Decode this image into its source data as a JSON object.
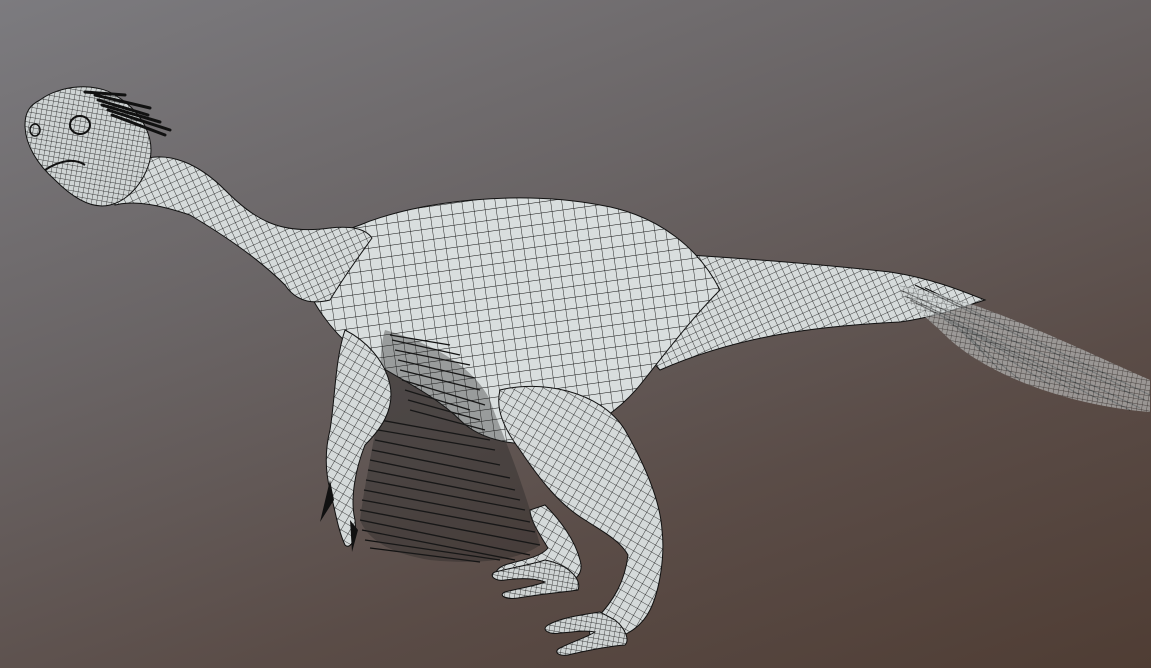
{
  "viewport": {
    "background_top": "#7c7b7f",
    "background_bottom": "#4f3d34",
    "mesh_fill": "#d7dcdc",
    "wire_color": "#111111",
    "feather_color": "#1a1a1a"
  },
  "model": {
    "kind": "wireframe-dinosaur-mesh",
    "parts": [
      "head",
      "neck",
      "body",
      "tail",
      "tail-feathers",
      "arm",
      "arm-feathers",
      "near-leg",
      "far-leg",
      "feet",
      "crest-feathers"
    ]
  }
}
